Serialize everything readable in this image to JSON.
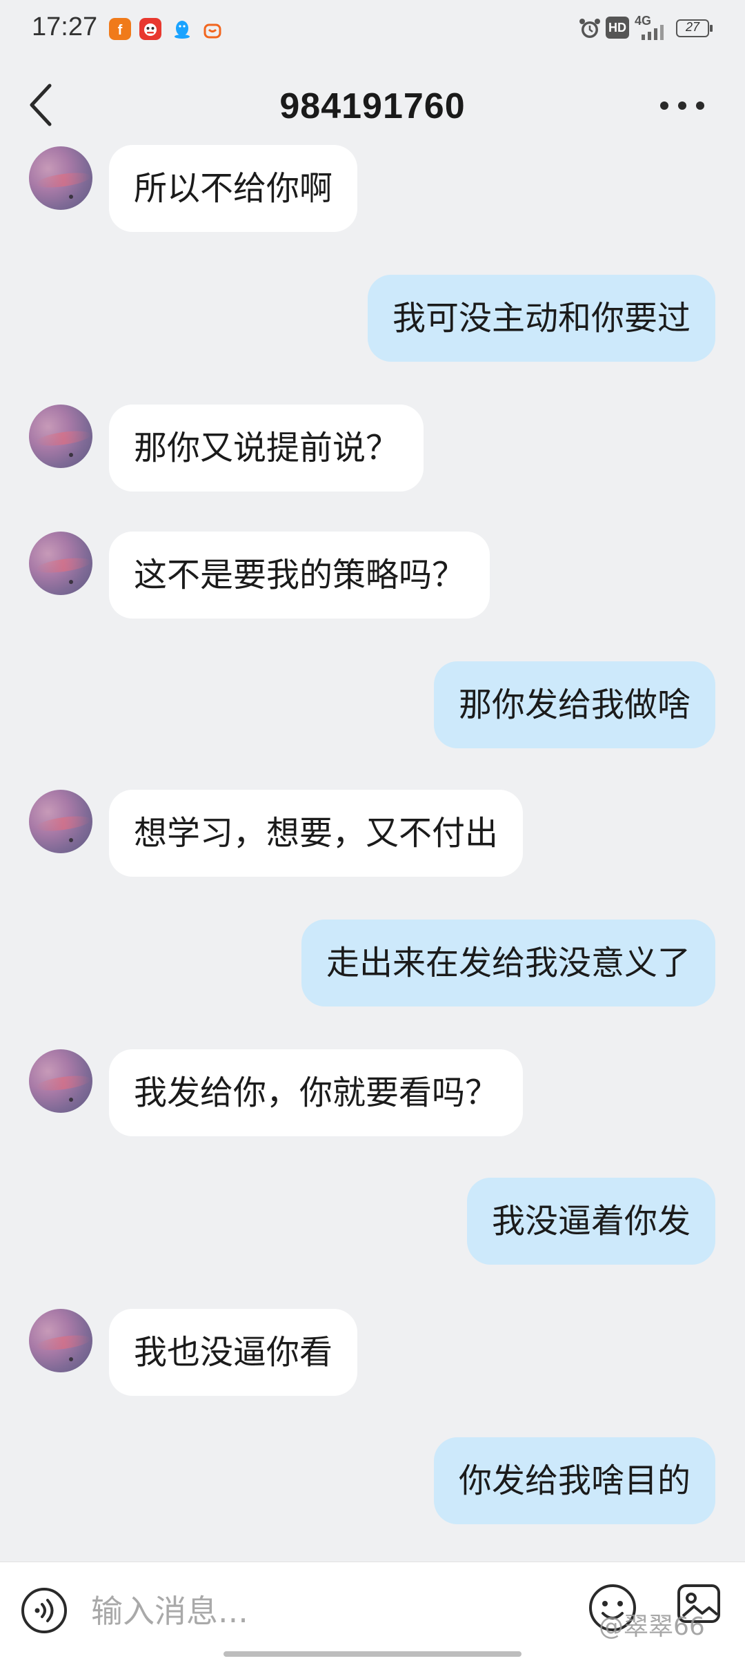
{
  "status_bar": {
    "time": "17:27",
    "network": "4G",
    "hd": "HD",
    "battery": "27",
    "app_icons": [
      "fire-app-icon",
      "mascot-app-icon",
      "qq-penguin-icon",
      "shopping-bag-icon"
    ],
    "right_icons": [
      "alarm-icon",
      "hd-icon",
      "signal-icon",
      "battery-icon"
    ]
  },
  "header": {
    "title": "984191760"
  },
  "messages": [
    {
      "side": "in",
      "text": "所以不给你啊"
    },
    {
      "side": "out",
      "text": "我可没主动和你要过"
    },
    {
      "side": "in",
      "text": "那你又说提前说？"
    },
    {
      "side": "in",
      "text": "这不是要我的策略吗？"
    },
    {
      "side": "out",
      "text": "那你发给我做啥"
    },
    {
      "side": "in",
      "text": "想学习，想要，又不付出"
    },
    {
      "side": "out",
      "text": "走出来在发给我没意义了"
    },
    {
      "side": "in",
      "text": "我发给你，你就要看吗？"
    },
    {
      "side": "out",
      "text": "我没逼着你发"
    },
    {
      "side": "in",
      "text": "我也没逼你看"
    },
    {
      "side": "out",
      "text": "你发给我啥目的"
    }
  ],
  "input_bar": {
    "placeholder": "输入消息...",
    "value": ""
  },
  "watermark": "@翠翠66",
  "colors": {
    "background": "#eff0f2",
    "incoming_bubble": "#ffffff",
    "outgoing_bubble": "#cde9fb",
    "text": "#1b1b1b"
  }
}
